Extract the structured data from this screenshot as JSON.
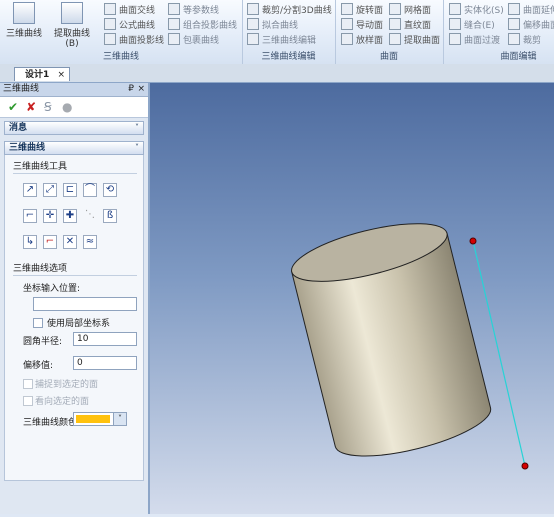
{
  "ribbon": {
    "groups": [
      {
        "id": "g1",
        "label": "三维曲线",
        "big_buttons": [
          {
            "label": "三维曲线"
          },
          {
            "label": "提取曲线(B)"
          }
        ],
        "small_buttons": [
          {
            "label": "曲面交线"
          },
          {
            "label": "公式曲线"
          },
          {
            "label": "曲面投影线"
          },
          {
            "label": "等参数线"
          },
          {
            "label": "组合投影曲线"
          },
          {
            "label": "包裹曲线"
          }
        ]
      },
      {
        "id": "g2",
        "label": "三维曲线编辑",
        "small_buttons": [
          {
            "label": "裁剪/分割3D曲线"
          },
          {
            "label": "拟合曲线"
          },
          {
            "label": "三维曲线编辑"
          }
        ]
      },
      {
        "id": "g3",
        "label": "曲面",
        "small_buttons": [
          {
            "label": "旋转面"
          },
          {
            "label": "导动面"
          },
          {
            "label": "放样面"
          },
          {
            "label": "网格面"
          },
          {
            "label": "直纹面"
          },
          {
            "label": "提取曲面"
          }
        ]
      },
      {
        "id": "g4",
        "label": "曲面编辑",
        "small_buttons": [
          {
            "label": "实体化(S)"
          },
          {
            "label": "缝合(E)"
          },
          {
            "label": "曲面过渡"
          },
          {
            "label": "曲面延伸"
          },
          {
            "label": "偏移曲面"
          },
          {
            "label": "裁剪"
          }
        ]
      }
    ]
  },
  "tabs": [
    {
      "label": "设计1",
      "close": "×"
    }
  ],
  "panel": {
    "title": "三维曲线",
    "pin": "₽",
    "close": "×",
    "message_section": "消息",
    "curve_section": "三维曲线",
    "tools_label": "三维曲线工具",
    "tool_glyphs": [
      "↗",
      "⤢",
      "⊏",
      "⌒",
      "⟲",
      "⌐",
      "✛",
      "✚",
      "⋱",
      "ß",
      "↳",
      "⌐",
      "✕",
      "≈"
    ],
    "options_label": "三维曲线选项",
    "coord_input_label": "坐标输入位置:",
    "coord_input_value": "",
    "use_local_cs_label": "使用局部坐标系",
    "fillet_radius_label": "圆角半径:",
    "fillet_radius_value": "10",
    "offset_label": "偏移值:",
    "offset_value": "0",
    "snap_to_face_label": "捕捉到选定的面",
    "view_face_label": "看向选定的面",
    "curve_color_label": "三维曲线颜色",
    "curve_color": "#ffc20e",
    "section_chevron": "˅"
  },
  "actions": {
    "ok": "✔",
    "cancel": "✘",
    "preview": "Ꞩ",
    "extra": "●"
  },
  "colors": {
    "accent": "#17365d",
    "ok_green": "#2f9a2f",
    "cancel_red": "#c82020",
    "curve_cyan": "#27d3d6",
    "point_red": "#d40000"
  }
}
